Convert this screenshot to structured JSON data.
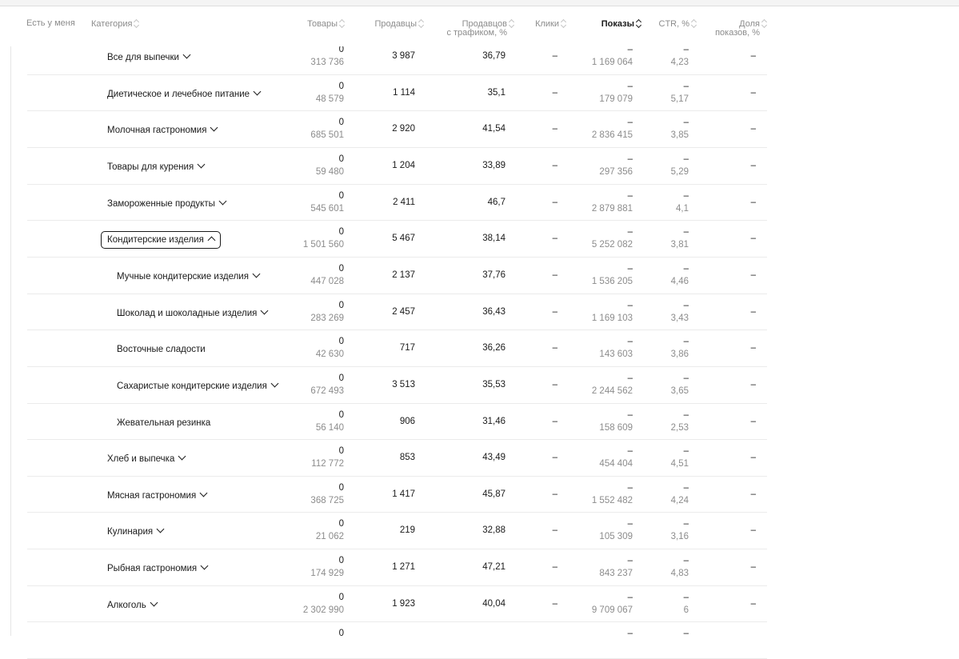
{
  "header": {
    "col_have": "Есть у меня",
    "col_category": "Категория",
    "col_goods": "Товары",
    "col_sellers": "Продавцы",
    "col_sellers_traffic_1": "Продавцов",
    "col_sellers_traffic_2": "с трафиком, %",
    "col_clicks": "Клики",
    "col_shows": "Показы",
    "col_ctr": "CTR, %",
    "col_share_1": "Доля",
    "col_share_2": "показов, %"
  },
  "rows": [
    {
      "name": "Все для выпечки",
      "level": 1,
      "expand": "down",
      "goods_top": "0",
      "goods_bot": "313 736",
      "sellers": "3 987",
      "pct": "36,79",
      "clicks": "–",
      "shows_top": "–",
      "shows_bot": "1 169 064",
      "ctr_top": "–",
      "ctr_bot": "4,23",
      "share": "–"
    },
    {
      "name": "Диетическое и лечебное питание",
      "level": 1,
      "expand": "down",
      "goods_top": "0",
      "goods_bot": "48 579",
      "sellers": "1 114",
      "pct": "35,1",
      "clicks": "–",
      "shows_top": "–",
      "shows_bot": "179 079",
      "ctr_top": "–",
      "ctr_bot": "5,17",
      "share": "–"
    },
    {
      "name": "Молочная гастрономия",
      "level": 1,
      "expand": "down",
      "goods_top": "0",
      "goods_bot": "685 501",
      "sellers": "2 920",
      "pct": "41,54",
      "clicks": "–",
      "shows_top": "–",
      "shows_bot": "2 836 415",
      "ctr_top": "–",
      "ctr_bot": "3,85",
      "share": "–"
    },
    {
      "name": "Товары для курения",
      "level": 1,
      "expand": "down",
      "goods_top": "0",
      "goods_bot": "59 480",
      "sellers": "1 204",
      "pct": "33,89",
      "clicks": "–",
      "shows_top": "–",
      "shows_bot": "297 356",
      "ctr_top": "–",
      "ctr_bot": "5,29",
      "share": "–"
    },
    {
      "name": "Замороженные продукты",
      "level": 1,
      "expand": "down",
      "goods_top": "0",
      "goods_bot": "545 601",
      "sellers": "2 411",
      "pct": "46,7",
      "clicks": "–",
      "shows_top": "–",
      "shows_bot": "2 879 881",
      "ctr_top": "–",
      "ctr_bot": "4,1",
      "share": "–"
    },
    {
      "name": "Кондитерские изделия",
      "level": 1,
      "expand": "up",
      "selected": true,
      "goods_top": "0",
      "goods_bot": "1 501 560",
      "sellers": "5 467",
      "pct": "38,14",
      "clicks": "–",
      "shows_top": "–",
      "shows_bot": "5 252 082",
      "ctr_top": "–",
      "ctr_bot": "3,81",
      "share": "–"
    },
    {
      "name": "Мучные кондитерские изделия",
      "level": 2,
      "expand": "down",
      "goods_top": "0",
      "goods_bot": "447 028",
      "sellers": "2 137",
      "pct": "37,76",
      "clicks": "–",
      "shows_top": "–",
      "shows_bot": "1 536 205",
      "ctr_top": "–",
      "ctr_bot": "4,46",
      "share": "–"
    },
    {
      "name": "Шоколад и шоколадные изделия",
      "level": 2,
      "expand": "down",
      "goods_top": "0",
      "goods_bot": "283 269",
      "sellers": "2 457",
      "pct": "36,43",
      "clicks": "–",
      "shows_top": "–",
      "shows_bot": "1 169 103",
      "ctr_top": "–",
      "ctr_bot": "3,43",
      "share": "–"
    },
    {
      "name": "Восточные сладости",
      "level": 2,
      "expand": "none",
      "goods_top": "0",
      "goods_bot": "42 630",
      "sellers": "717",
      "pct": "36,26",
      "clicks": "–",
      "shows_top": "–",
      "shows_bot": "143 603",
      "ctr_top": "–",
      "ctr_bot": "3,86",
      "share": "–"
    },
    {
      "name": "Сахаристые кондитерские изделия",
      "level": 2,
      "expand": "down",
      "goods_top": "0",
      "goods_bot": "672 493",
      "sellers": "3 513",
      "pct": "35,53",
      "clicks": "–",
      "shows_top": "–",
      "shows_bot": "2 244 562",
      "ctr_top": "–",
      "ctr_bot": "3,65",
      "share": "–"
    },
    {
      "name": "Жевательная резинка",
      "level": 2,
      "expand": "none",
      "goods_top": "0",
      "goods_bot": "56 140",
      "sellers": "906",
      "pct": "31,46",
      "clicks": "–",
      "shows_top": "–",
      "shows_bot": "158 609",
      "ctr_top": "–",
      "ctr_bot": "2,53",
      "share": "–"
    },
    {
      "name": "Хлеб и выпечка",
      "level": 1,
      "expand": "down",
      "goods_top": "0",
      "goods_bot": "112 772",
      "sellers": "853",
      "pct": "43,49",
      "clicks": "–",
      "shows_top": "–",
      "shows_bot": "454 404",
      "ctr_top": "–",
      "ctr_bot": "4,51",
      "share": "–"
    },
    {
      "name": "Мясная гастрономия",
      "level": 1,
      "expand": "down",
      "goods_top": "0",
      "goods_bot": "368 725",
      "sellers": "1 417",
      "pct": "45,87",
      "clicks": "–",
      "shows_top": "–",
      "shows_bot": "1 552 482",
      "ctr_top": "–",
      "ctr_bot": "4,24",
      "share": "–"
    },
    {
      "name": "Кулинария",
      "level": 1,
      "expand": "down",
      "goods_top": "0",
      "goods_bot": "21 062",
      "sellers": "219",
      "pct": "32,88",
      "clicks": "–",
      "shows_top": "–",
      "shows_bot": "105 309",
      "ctr_top": "–",
      "ctr_bot": "3,16",
      "share": "–"
    },
    {
      "name": "Рыбная гастрономия",
      "level": 1,
      "expand": "down",
      "goods_top": "0",
      "goods_bot": "174 929",
      "sellers": "1 271",
      "pct": "47,21",
      "clicks": "–",
      "shows_top": "–",
      "shows_bot": "843 237",
      "ctr_top": "–",
      "ctr_bot": "4,83",
      "share": "–"
    },
    {
      "name": "Алкоголь",
      "level": 1,
      "expand": "down",
      "goods_top": "0",
      "goods_bot": "2 302 990",
      "sellers": "1 923",
      "pct": "40,04",
      "clicks": "–",
      "shows_top": "–",
      "shows_bot": "9 709 067",
      "ctr_top": "–",
      "ctr_bot": "6",
      "share": "–"
    },
    {
      "name": "",
      "level": 1,
      "expand": "none",
      "goods_top": "0",
      "goods_bot": "",
      "sellers": "",
      "pct": "",
      "clicks": "",
      "shows_top": "–",
      "shows_bot": "",
      "ctr_top": "–",
      "ctr_bot": "",
      "share": ""
    }
  ]
}
